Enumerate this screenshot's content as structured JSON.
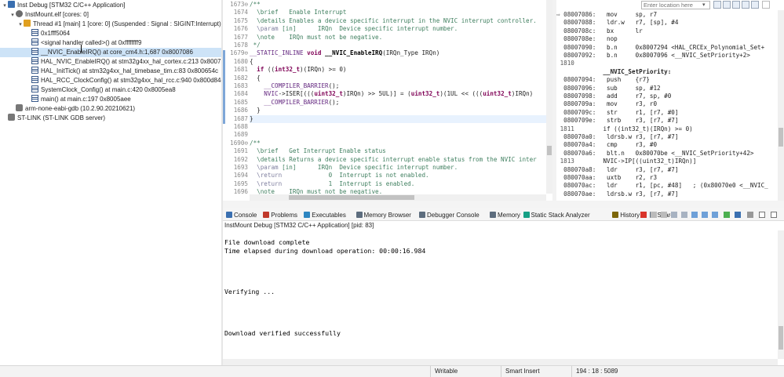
{
  "debug_tree": [
    {
      "text": "Inst        Debug [STM32 C/C++ Application]",
      "icon": "launch-config-icon",
      "twisty": "expanded",
      "indent": 0
    },
    {
      "text": "InstMount.elf [cores: 0]",
      "icon": "process-icon",
      "twisty": "expanded",
      "indent": 1
    },
    {
      "text": "Thread #1 [main] 1 [core: 0] (Suspended : Signal : SIGINT:Interrupt)",
      "icon": "thread-icon",
      "twisty": "expanded",
      "indent": 2
    },
    {
      "text": "0x1fff5064",
      "icon": "stack-frame-icon",
      "twisty": "",
      "indent": 3
    },
    {
      "text": "<signal handler called>() at 0xffffffff9",
      "icon": "stack-frame-icon",
      "twisty": "",
      "indent": 3
    },
    {
      "text": "__NVIC_EnableIRQ() at core_cm4.h:1,687 0x8007086",
      "icon": "stack-frame-icon",
      "twisty": "",
      "indent": 3,
      "selected": true
    },
    {
      "text": "HAL_NVIC_EnableIRQ() at stm32g4xx_hal_cortex.c:213 0x80071ac",
      "icon": "stack-frame-icon",
      "twisty": "",
      "indent": 3
    },
    {
      "text": "HAL_InitTick() at stm32g4xx_hal_timebase_tim.c:83 0x800654c",
      "icon": "stack-frame-icon",
      "twisty": "",
      "indent": 3
    },
    {
      "text": "HAL_RCC_ClockConfig() at stm32g4xx_hal_rcc.c:940 0x800d84c",
      "icon": "stack-frame-icon",
      "twisty": "",
      "indent": 3
    },
    {
      "text": "SystemClock_Config() at main.c:420 0x8005ea8",
      "icon": "stack-frame-icon",
      "twisty": "",
      "indent": 3
    },
    {
      "text": "main() at main.c:197 0x8005aee",
      "icon": "stack-frame-icon",
      "twisty": "",
      "indent": 3
    },
    {
      "text": "arm-none-eabi-gdb (10.2.90.20210621)",
      "icon": "gdb-icon",
      "twisty": "",
      "indent": 1
    },
    {
      "text": "ST-LINK (ST-LINK GDB server)",
      "icon": "gdb-icon",
      "twisty": "",
      "indent": 0
    }
  ],
  "editor": {
    "lines": [
      {
        "n": "1673",
        "fold": "⊖",
        "html": "<span class=\"cm\">/**</span>"
      },
      {
        "n": "1674",
        "html": "<span class=\"cm\">  \\brief   Enable Interrupt</span>"
      },
      {
        "n": "1675",
        "html": "<span class=\"cm\">  \\details Enables a device specific interrupt in the NVIC interrupt controller.</span>"
      },
      {
        "n": "1676",
        "html": "<span class=\"cm\">  <span class=\"tag\">\\param</span> [in]      IRQn  Device specific interrupt number.</span>"
      },
      {
        "n": "1677",
        "html": "<span class=\"cm\">  \\note    IRQn must not be negative.</span>"
      },
      {
        "n": "1678",
        "html": "<span class=\"cm\"> */</span>"
      },
      {
        "n": "1679",
        "fold": "⊖",
        "html": "<span class=\"mac\">__STATIC_INLINE</span> <span class=\"kw\">void</span> <span class=\"fn\">__NVIC_EnableIRQ</span>(IRQn_Type IRQn)"
      },
      {
        "n": "1680",
        "html": "{"
      },
      {
        "n": "1681",
        "html": "  <span class=\"kw\">if</span> ((<span class=\"kw\">int32_t</span>)(IRQn) >= 0)"
      },
      {
        "n": "1682",
        "html": "  {"
      },
      {
        "n": "1683",
        "html": "    <span class=\"mac\">__COMPILER_BARRIER</span>();"
      },
      {
        "n": "1684",
        "html": "    <span class=\"mac\">NVIC</span>->ISER[(((<span class=\"kw\">uint32_t</span>)IRQn) >> 5UL)] = (<span class=\"kw\">uint32_t</span>)(1UL << (((<span class=\"kw\">uint32_t</span>)IRQn)"
      },
      {
        "n": "1685",
        "html": "    <span class=\"mac\">__COMPILER_BARRIER</span>();"
      },
      {
        "n": "1686",
        "html": "  }"
      },
      {
        "n": "1687",
        "html": "}",
        "current": true
      },
      {
        "n": "1688",
        "html": ""
      },
      {
        "n": "1689",
        "html": ""
      },
      {
        "n": "1690",
        "fold": "⊖",
        "html": "<span class=\"cm\">/**</span>"
      },
      {
        "n": "1691",
        "html": "<span class=\"cm\">  \\brief   Get Interrupt Enable status</span>"
      },
      {
        "n": "1692",
        "html": "<span class=\"cm\">  \\details Returns a device specific interrupt enable status from the NVIC inter</span>"
      },
      {
        "n": "1693",
        "html": "<span class=\"cm\">  <span class=\"tag\">\\param</span> [in]      IRQn  Device specific interrupt number.</span>"
      },
      {
        "n": "1694",
        "html": "<span class=\"cm\">  <span class=\"tag\">\\return</span>             0  Interrupt is not enabled.</span>"
      },
      {
        "n": "1695",
        "html": "<span class=\"cm\">  <span class=\"tag\">\\return</span>             1  Interrupt is enabled.</span>"
      },
      {
        "n": "1696",
        "html": "<span class=\"cm\">  \\note    IRQn must not be negative.</span>"
      }
    ]
  },
  "disassembly": {
    "location_placeholder": "Enter location here",
    "rows": [
      {
        "addr": "08007086:",
        "mn": "mov",
        "ops": "sp, r7",
        "type": "ins",
        "current": true
      },
      {
        "addr": "08007088:",
        "mn": "ldr.w",
        "ops": "r7, [sp], #4",
        "type": "ins"
      },
      {
        "addr": "0800708c:",
        "mn": "bx",
        "ops": "lr",
        "type": "ins"
      },
      {
        "addr": "0800708e:",
        "mn": "nop",
        "ops": "",
        "type": "ins"
      },
      {
        "addr": "08007090:",
        "mn": "b.n",
        "ops": "0x8007294 <HAL_CRCEx_Polynomial_Set+",
        "type": "ins"
      },
      {
        "addr": "08007092:",
        "mn": "b.n",
        "ops": "0x8007096 <__NVIC_SetPriority+2>",
        "type": "ins"
      },
      {
        "addr": "1810",
        "mn": "",
        "ops": "",
        "type": "line"
      },
      {
        "addr": "",
        "mn": "",
        "ops": "__NVIC_SetPriority:",
        "type": "label"
      },
      {
        "addr": "08007094:",
        "mn": "push",
        "ops": "{r7}",
        "type": "ins"
      },
      {
        "addr": "08007096:",
        "mn": "sub",
        "ops": "sp, #12",
        "type": "ins"
      },
      {
        "addr": "08007098:",
        "mn": "add",
        "ops": "r7, sp, #0",
        "type": "ins"
      },
      {
        "addr": "0800709a:",
        "mn": "mov",
        "ops": "r3, r0",
        "type": "ins"
      },
      {
        "addr": "0800709c:",
        "mn": "str",
        "ops": "r1, [r7, #0]",
        "type": "ins"
      },
      {
        "addr": "0800709e:",
        "mn": "strb",
        "ops": "r3, [r7, #7]",
        "type": "ins"
      },
      {
        "addr": "1811",
        "mn": "",
        "ops": "if ((int32_t)(IRQn) >= 0)",
        "type": "line"
      },
      {
        "addr": "080070a0:",
        "mn": "ldrsb.w",
        "ops": "r3, [r7, #7]",
        "type": "ins"
      },
      {
        "addr": "080070a4:",
        "mn": "cmp",
        "ops": "r3, #0",
        "type": "ins"
      },
      {
        "addr": "080070a6:",
        "mn": "blt.n",
        "ops": "0x80070be <__NVIC_SetPriority+42>",
        "type": "ins"
      },
      {
        "addr": "1813",
        "mn": "",
        "ops": "NVIC->IP[((uint32_t)IRQn)]",
        "type": "line"
      },
      {
        "addr": "080070a8:",
        "mn": "ldr",
        "ops": "r3, [r7, #7]",
        "type": "ins"
      },
      {
        "addr": "080070aa:",
        "mn": "uxtb",
        "ops": "r2, r3",
        "type": "ins"
      },
      {
        "addr": "080070ac:",
        "mn": "ldr",
        "ops": "r1, [pc, #48]   ; (0x80070e0 <__NVIC_",
        "type": "ins"
      },
      {
        "addr": "080070ae:",
        "mn": "ldrsb.w",
        "ops": "r3, [r7, #7]",
        "type": "ins"
      }
    ]
  },
  "console": {
    "tabs": [
      {
        "label": "Console",
        "color": "#3a6fb0",
        "active": true
      },
      {
        "label": "Problems",
        "color": "#c0392b"
      },
      {
        "label": "Executables",
        "color": "#2e86c1"
      },
      {
        "label": "Memory Browser",
        "color": "#5d6d7e"
      },
      {
        "label": "Debugger Console",
        "color": "#5d6d7e"
      },
      {
        "label": "Memory",
        "color": "#5d6d7e"
      },
      {
        "label": "Static Stack Analyzer",
        "color": "#16a085"
      },
      {
        "label": "History",
        "color": "#7d6608"
      },
      {
        "label": "Search",
        "color": "#5d6d7e"
      }
    ],
    "title": "InstMount Debug [STM32 C/C++ Application] [pid: 83]",
    "output": "File download complete\nTime elapsed during download operation: 00:00:16.984\n\n\n\n\nVerifying ...\n\n\n\n\nDownload verified successfully"
  },
  "statusbar": {
    "mode": "Writable",
    "insert": "Smart Insert",
    "position": "194 : 18 : 5089"
  },
  "colors": {
    "selection": "#cde3f7",
    "current_line": "#e8f2fe",
    "comment": "#3f7f5f",
    "keyword": "#7f0055"
  }
}
